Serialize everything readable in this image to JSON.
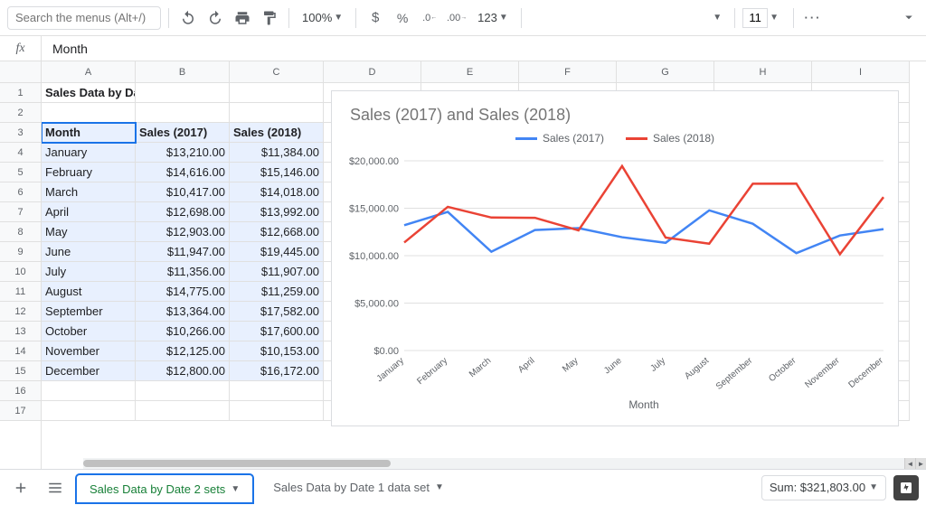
{
  "toolbar": {
    "search_placeholder": "Search the menus (Alt+/)",
    "zoom": "100%",
    "font_size": "11",
    "format_123": "123"
  },
  "formula_bar": {
    "value": "Month"
  },
  "columns": [
    "A",
    "B",
    "C",
    "D",
    "E",
    "F",
    "G",
    "H",
    "I"
  ],
  "row_numbers": [
    "1",
    "2",
    "3",
    "4",
    "5",
    "6",
    "7",
    "8",
    "9",
    "10",
    "11",
    "12",
    "13",
    "14",
    "15",
    "16",
    "17"
  ],
  "sheet_title_cell": "Sales Data by Date",
  "headers": {
    "month": "Month",
    "s2017": "Sales (2017)",
    "s2018": "Sales (2018)"
  },
  "data_rows": [
    {
      "m": "January",
      "a": "$13,210.00",
      "b": "$11,384.00"
    },
    {
      "m": "February",
      "a": "$14,616.00",
      "b": "$15,146.00"
    },
    {
      "m": "March",
      "a": "$10,417.00",
      "b": "$14,018.00"
    },
    {
      "m": "April",
      "a": "$12,698.00",
      "b": "$13,992.00"
    },
    {
      "m": "May",
      "a": "$12,903.00",
      "b": "$12,668.00"
    },
    {
      "m": "June",
      "a": "$11,947.00",
      "b": "$19,445.00"
    },
    {
      "m": "July",
      "a": "$11,356.00",
      "b": "$11,907.00"
    },
    {
      "m": "August",
      "a": "$14,775.00",
      "b": "$11,259.00"
    },
    {
      "m": "September",
      "a": "$13,364.00",
      "b": "$17,582.00"
    },
    {
      "m": "October",
      "a": "$10,266.00",
      "b": "$17,600.00"
    },
    {
      "m": "November",
      "a": "$12,125.00",
      "b": "$10,153.00"
    },
    {
      "m": "December",
      "a": "$12,800.00",
      "b": "$16,172.00"
    }
  ],
  "chart": {
    "title": "Sales (2017) and Sales (2018)",
    "legend": {
      "a": "Sales (2017)",
      "b": "Sales (2018)"
    },
    "xlabel": "Month",
    "yticks": [
      "$0.00",
      "$5,000.00",
      "$10,000.00",
      "$15,000.00",
      "$20,000.00"
    ]
  },
  "chart_data": {
    "type": "line",
    "title": "Sales (2017) and Sales (2018)",
    "xlabel": "Month",
    "ylabel": "",
    "ylim": [
      0,
      20000
    ],
    "categories": [
      "January",
      "February",
      "March",
      "April",
      "May",
      "June",
      "July",
      "August",
      "September",
      "October",
      "November",
      "December"
    ],
    "series": [
      {
        "name": "Sales (2017)",
        "color": "#4285f4",
        "values": [
          13210,
          14616,
          10417,
          12698,
          12903,
          11947,
          11356,
          14775,
          13364,
          10266,
          12125,
          12800
        ]
      },
      {
        "name": "Sales (2018)",
        "color": "#ea4335",
        "values": [
          11384,
          15146,
          14018,
          13992,
          12668,
          19445,
          11907,
          11259,
          17582,
          17600,
          10153,
          16172
        ]
      }
    ]
  },
  "tabs": {
    "active": "Sales Data by Date 2 sets",
    "other": "Sales Data by Date 1 data set"
  },
  "statusbar": {
    "sum": "Sum: $321,803.00"
  },
  "colors": {
    "blue": "#4285f4",
    "red": "#ea4335"
  }
}
